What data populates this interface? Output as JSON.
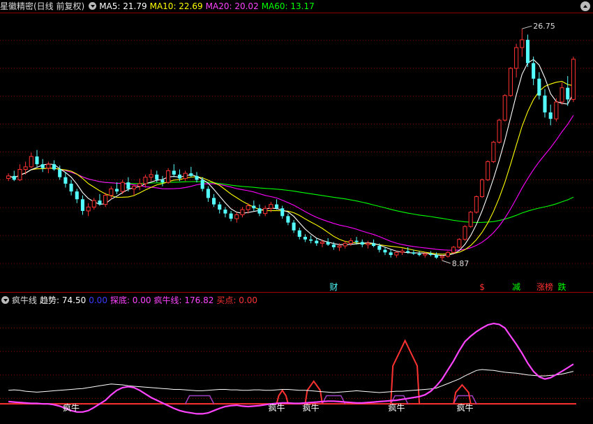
{
  "main_header": {
    "title": "星徽精密(日线 前复权)",
    "ma5": "MA5: 21.79",
    "ma10": "MA10: 22.69",
    "ma20": "MA20: 20.02",
    "ma60": "MA60: 13.17"
  },
  "indicator_header": {
    "name": "疯牛线",
    "trend": "趋势: 74.50",
    "blue_value": "0.00",
    "bottom": "探底: 0.00",
    "bull_line": "疯牛线: 176.82",
    "buy": "买点: 0.00"
  },
  "colors": {
    "ma5": "#ffffff",
    "ma10": "#ffff00",
    "ma20": "#ff00ff",
    "ma60": "#00ff00",
    "up": "#ff3232",
    "down": "#54ffff",
    "grid": "#880000"
  },
  "chart_data": [
    {
      "type": "candlestick",
      "title": "星徽精密(日线 前复权)",
      "ylim": [
        6.5,
        28
      ],
      "annotations": [
        {
          "text": "26.75",
          "kind": "high"
        },
        {
          "text": "8.87",
          "kind": "low"
        }
      ],
      "markers": [
        {
          "text": "财",
          "color": "#54ffff"
        },
        {
          "text": "$",
          "color": "#ff3232"
        },
        {
          "text": "减",
          "color": "#00ff00"
        },
        {
          "text": "涨榜",
          "color": "#ff3232"
        },
        {
          "text": "跌",
          "color": "#00ff00"
        }
      ],
      "candles": [
        [
          15.2,
          15.6,
          15,
          15.4
        ],
        [
          15.4,
          15.8,
          15,
          15.1
        ],
        [
          15.1,
          16.3,
          15,
          15.9
        ],
        [
          15.9,
          16.5,
          15.5,
          16.1
        ],
        [
          16.1,
          17.2,
          16,
          16.9
        ],
        [
          16.9,
          17.4,
          16.1,
          16.3
        ],
        [
          16.3,
          16.7,
          15.7,
          16
        ],
        [
          16,
          16.5,
          15.6,
          16.3
        ],
        [
          16.3,
          16.6,
          15.8,
          15.9
        ],
        [
          15.9,
          16.2,
          15.1,
          15.3
        ],
        [
          15.3,
          15.7,
          14.5,
          14.8
        ],
        [
          14.8,
          15.1,
          13.9,
          14.2
        ],
        [
          14.2,
          14.4,
          13.3,
          13.6
        ],
        [
          13.6,
          13.9,
          12.4,
          12.7
        ],
        [
          12.7,
          13.3,
          12.3,
          13
        ],
        [
          13,
          13.7,
          12.8,
          13.5
        ],
        [
          13.5,
          14,
          13.1,
          13.2
        ],
        [
          13.2,
          14.1,
          13,
          13.9
        ],
        [
          13.9,
          14.6,
          13.6,
          14.4
        ],
        [
          14.4,
          14.9,
          14,
          14.2
        ],
        [
          14.2,
          15.1,
          14,
          14.9
        ],
        [
          14.9,
          15.3,
          14.2,
          14.4
        ],
        [
          14.4,
          14.7,
          13.9,
          14.6
        ],
        [
          14.6,
          15.2,
          14.3,
          14.8
        ],
        [
          14.8,
          15.5,
          14.5,
          15.3
        ],
        [
          15.3,
          15.9,
          15,
          15.5
        ],
        [
          15.5,
          15.8,
          14.9,
          15.1
        ],
        [
          15.1,
          15.4,
          14.6,
          14.9
        ],
        [
          14.9,
          16,
          14.8,
          15.8
        ],
        [
          15.8,
          16.3,
          15.3,
          15.5
        ],
        [
          15.5,
          15.9,
          15,
          15.2
        ],
        [
          15.2,
          15.8,
          15,
          15.6
        ],
        [
          15.6,
          16.1,
          15.3,
          15.4
        ],
        [
          15.4,
          15.7,
          14.9,
          15.1
        ],
        [
          15.1,
          15.3,
          14.2,
          14.4
        ],
        [
          14.4,
          14.6,
          13.4,
          13.7
        ],
        [
          13.7,
          14,
          13,
          13.2
        ],
        [
          13.2,
          13.4,
          12.5,
          12.8
        ],
        [
          12.8,
          13,
          12.2,
          12.5
        ],
        [
          12.5,
          12.7,
          11.9,
          12.1
        ],
        [
          12.1,
          12.6,
          11.8,
          12.4
        ],
        [
          12.4,
          13,
          12.2,
          12.8
        ],
        [
          12.8,
          13.3,
          12.5,
          13.1
        ],
        [
          13.1,
          13.5,
          12.7,
          12.9
        ],
        [
          12.9,
          13.2,
          12.3,
          12.5
        ],
        [
          12.5,
          13.1,
          12.3,
          12.9
        ],
        [
          12.9,
          13.4,
          12.6,
          13.2
        ],
        [
          13.2,
          13.6,
          12.8,
          12.9
        ],
        [
          12.9,
          13.1,
          12.1,
          12.3
        ],
        [
          12.3,
          12.5,
          11.6,
          11.8
        ],
        [
          11.8,
          12,
          11,
          11.2
        ],
        [
          11.2,
          11.4,
          10.5,
          10.7
        ],
        [
          10.7,
          10.9,
          10.3,
          10.5
        ],
        [
          10.5,
          10.8,
          10.2,
          10.4
        ],
        [
          10.4,
          10.6,
          10,
          10.2
        ],
        [
          10.2,
          10.5,
          9.9,
          10.3
        ],
        [
          10.3,
          10.6,
          10,
          10.1
        ],
        [
          10.1,
          10.3,
          9.7,
          9.9
        ],
        [
          9.9,
          10.2,
          9.6,
          10
        ],
        [
          10,
          10.4,
          9.8,
          10.2
        ],
        [
          10.2,
          10.6,
          10,
          10.4
        ],
        [
          10.4,
          10.7,
          10.1,
          10.3
        ],
        [
          10.3,
          10.5,
          9.9,
          10.1
        ],
        [
          10.1,
          10.4,
          9.8,
          10.2
        ],
        [
          10.2,
          10.5,
          9.9,
          10
        ],
        [
          10,
          10.2,
          9.5,
          9.7
        ],
        [
          9.7,
          9.9,
          9.3,
          9.5
        ],
        [
          9.5,
          9.7,
          9.1,
          9.3
        ],
        [
          9.3,
          9.6,
          9.1,
          9.5
        ],
        [
          9.5,
          9.8,
          9.3,
          9.6
        ],
        [
          9.6,
          9.9,
          9.4,
          9.5
        ],
        [
          9.5,
          9.7,
          9.3,
          9.4
        ],
        [
          9.4,
          9.6,
          9.2,
          9.3
        ],
        [
          9.3,
          9.5,
          9.1,
          9.4
        ],
        [
          9.4,
          9.6,
          9.2,
          9.3
        ],
        [
          9.3,
          9.5,
          9,
          9.1
        ],
        [
          9.1,
          9.3,
          8.87,
          9.2
        ],
        [
          9.2,
          9.6,
          9.1,
          9.5
        ],
        [
          9.5,
          10,
          9.4,
          9.9
        ],
        [
          9.9,
          10.6,
          9.8,
          10.5
        ],
        [
          10.5,
          11.6,
          10.4,
          11.5
        ],
        [
          11.5,
          12.7,
          11.4,
          12.6
        ],
        [
          12.6,
          13.9,
          12.5,
          13.8
        ],
        [
          13.8,
          15.2,
          13.7,
          15.1
        ],
        [
          15.1,
          16.6,
          15,
          16.5
        ],
        [
          16.5,
          18.1,
          16.4,
          18
        ],
        [
          18,
          19.8,
          17.9,
          19.7
        ],
        [
          19.7,
          21.7,
          19.6,
          21.6
        ],
        [
          21.6,
          23.8,
          21.5,
          23.7
        ],
        [
          23.7,
          25.6,
          23,
          25.3
        ],
        [
          25.3,
          26.75,
          24.6,
          25.9
        ],
        [
          25.9,
          26.3,
          23.8,
          24.1
        ],
        [
          24.1,
          24.6,
          22.4,
          22.9
        ],
        [
          22.9,
          23.4,
          21.3,
          21.6
        ],
        [
          21.6,
          22.1,
          19.9,
          20.3
        ],
        [
          20.3,
          20.9,
          19.3,
          19.8
        ],
        [
          19.8,
          21.4,
          19.6,
          21.1
        ],
        [
          21.1,
          22.6,
          20.9,
          22.2
        ],
        [
          22.2,
          23.1,
          20.8,
          21.3
        ],
        [
          21.3,
          24.6,
          21.1,
          24.4
        ]
      ]
    },
    {
      "type": "line",
      "title": "疯牛线",
      "ylim": [
        -40,
        220
      ],
      "series": [
        {
          "name": "趋势",
          "color": "#ffffff",
          "values": [
            30,
            31,
            30,
            28,
            27,
            26,
            27,
            28,
            29,
            30,
            31,
            32,
            33,
            34,
            36,
            38,
            40,
            42,
            44,
            43,
            42,
            40,
            39,
            38,
            37,
            36,
            35,
            34,
            33,
            32,
            32,
            31,
            30,
            29,
            29,
            30,
            31,
            32,
            32,
            31,
            31,
            30,
            30,
            31,
            31,
            30,
            30,
            31,
            32,
            32,
            31,
            30,
            30,
            29,
            28,
            27,
            26,
            25,
            26,
            27,
            28,
            29,
            28,
            27,
            26,
            25,
            26,
            27,
            28,
            28,
            29,
            30,
            31,
            32,
            33,
            35,
            40,
            45,
            50,
            55,
            62,
            68,
            74,
            76,
            75,
            74,
            72,
            70,
            69,
            68,
            66,
            64,
            63,
            62,
            62,
            63,
            64,
            66,
            69,
            72
          ]
        },
        {
          "name": "疯牛线",
          "color": "#ff44ff",
          "values": [
            5,
            4,
            3,
            2,
            1,
            1,
            0,
            0,
            -2,
            -5,
            -10,
            -15,
            -18,
            -18,
            -15,
            -8,
            0,
            8,
            20,
            30,
            36,
            38,
            36,
            30,
            22,
            14,
            8,
            2,
            -4,
            -10,
            -15,
            -18,
            -20,
            -22,
            -22,
            -20,
            -15,
            -10,
            -6,
            -4,
            -3,
            -5,
            -6,
            -5,
            -4,
            -2,
            0,
            1,
            2,
            2,
            1,
            1,
            2,
            3,
            4,
            5,
            6,
            6,
            5,
            4,
            3,
            2,
            2,
            3,
            4,
            5,
            6,
            7,
            8,
            10,
            12,
            14,
            16,
            20,
            28,
            40,
            55,
            75,
            95,
            118,
            138,
            150,
            160,
            168,
            175,
            178,
            176,
            168,
            150,
            132,
            112,
            90,
            72,
            60,
            55,
            58,
            65,
            72,
            80,
            88
          ]
        },
        {
          "name": "买点",
          "color": "#ff3232",
          "values": [
            0,
            0,
            0,
            0,
            0,
            0,
            0,
            0,
            0,
            0,
            0,
            0,
            0,
            0,
            0,
            0,
            0,
            0,
            0,
            0,
            0,
            0,
            0,
            0,
            0,
            0,
            0,
            0,
            0,
            0,
            0,
            0,
            0,
            0,
            0,
            0,
            0,
            0,
            0,
            0,
            0,
            0,
            0,
            0,
            0,
            0,
            0,
            0,
            0,
            0,
            0,
            0,
            0,
            0,
            0,
            0,
            0,
            0,
            0,
            0,
            0,
            0,
            0,
            0,
            0,
            0,
            0,
            0,
            0,
            0,
            0,
            0,
            0,
            0,
            0,
            0,
            0,
            0,
            0,
            0,
            0,
            0,
            0,
            0,
            0,
            0,
            0,
            0,
            0,
            0,
            0,
            0,
            0,
            0,
            0,
            0,
            0,
            0,
            0,
            0
          ]
        },
        {
          "name": "探底",
          "color": "#ff44ff",
          "values": [
            0,
            0,
            0,
            0,
            0,
            0,
            0,
            0,
            0,
            0,
            0,
            0,
            0,
            0,
            0,
            0,
            0,
            0,
            0,
            0,
            0,
            0,
            0,
            0,
            0,
            0,
            0,
            0,
            0,
            0,
            0,
            0,
            0,
            0,
            0,
            0,
            0,
            0,
            0,
            0,
            0,
            0,
            0,
            0,
            0,
            0,
            0,
            0,
            0,
            0,
            0,
            0,
            0,
            0,
            0,
            0,
            0,
            0,
            0,
            0,
            0,
            0,
            0,
            0,
            0,
            0,
            0,
            0,
            0,
            0,
            0,
            0,
            0,
            0,
            0,
            0,
            0,
            0,
            0,
            0,
            0,
            0,
            0,
            0,
            0,
            0,
            0,
            0,
            0,
            0,
            0,
            0,
            0,
            0,
            0,
            0,
            0,
            0,
            0,
            0
          ]
        }
      ],
      "signals": [
        "疯牛",
        "疯牛",
        "疯牛",
        "疯牛",
        "疯牛"
      ]
    }
  ]
}
